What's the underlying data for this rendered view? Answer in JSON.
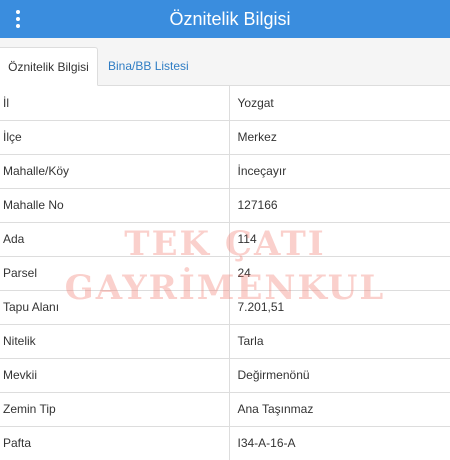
{
  "header": {
    "title": "Öznitelik Bilgisi",
    "menu_icon": "more-vertical-icon"
  },
  "tabs": [
    {
      "label": "Öznitelik Bilgisi",
      "active": true
    },
    {
      "label": "Bina/BB Listesi",
      "active": false
    }
  ],
  "attributes": [
    {
      "key": "İl",
      "value": "Yozgat"
    },
    {
      "key": "İlçe",
      "value": "Merkez"
    },
    {
      "key": "Mahalle/Köy",
      "value": "İnceçayır"
    },
    {
      "key": "Mahalle No",
      "value": "127166"
    },
    {
      "key": "Ada",
      "value": "114"
    },
    {
      "key": "Parsel",
      "value": "24"
    },
    {
      "key": "Tapu Alanı",
      "value": "7.201,51"
    },
    {
      "key": "Nitelik",
      "value": "Tarla"
    },
    {
      "key": "Mevkii",
      "value": "Değirmenönü"
    },
    {
      "key": "Zemin Tip",
      "value": "Ana Taşınmaz"
    },
    {
      "key": "Pafta",
      "value": "I34-A-16-A"
    }
  ],
  "watermark": {
    "line1": "TEK ÇATI",
    "line2": "GAYRİMENKUL"
  },
  "colors": {
    "header_bg": "#3a8dde",
    "tab_link": "#2f7dc4",
    "watermark": "#f0786e"
  }
}
